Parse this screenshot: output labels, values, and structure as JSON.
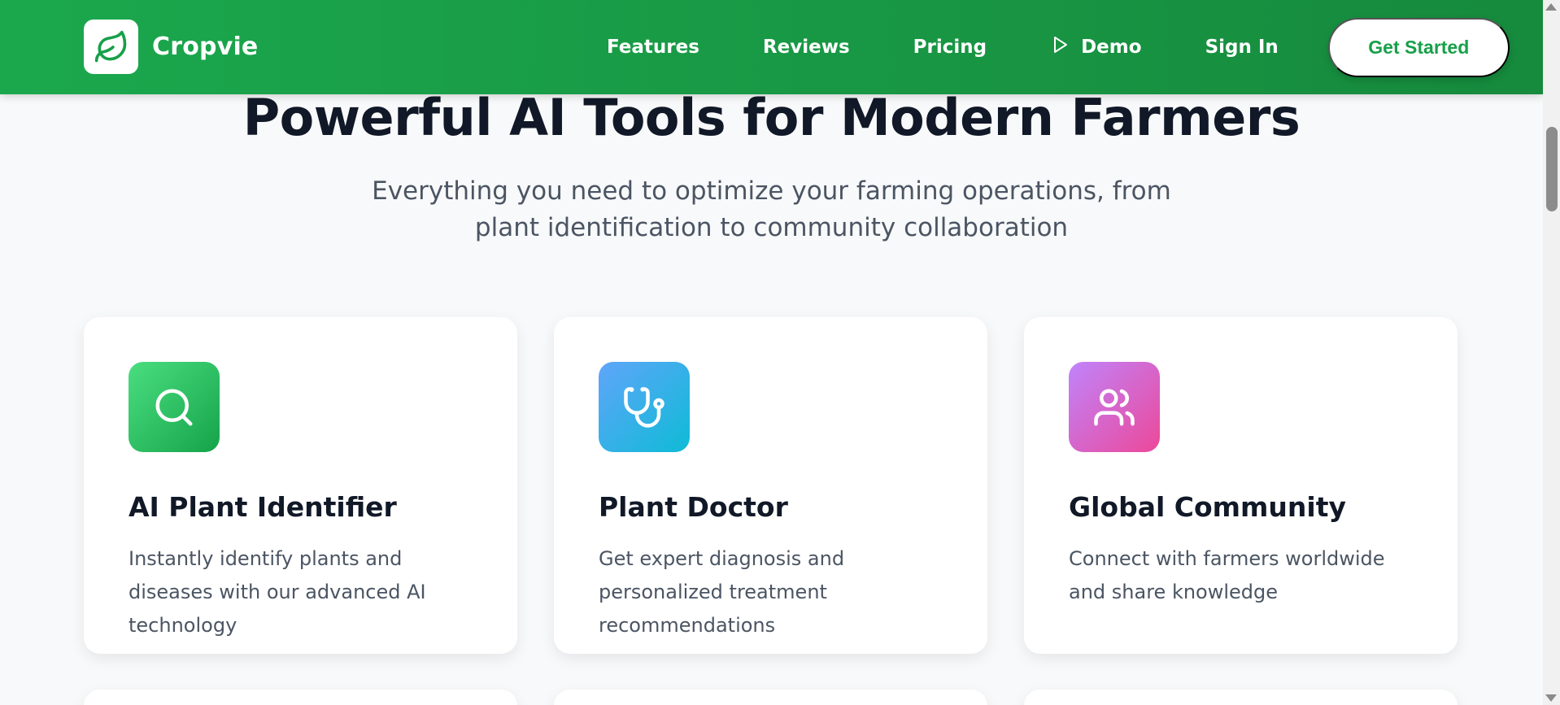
{
  "header": {
    "brand_name": "Cropvie",
    "brand_icon": "leaf-icon",
    "nav": {
      "features": "Features",
      "reviews": "Reviews",
      "pricing": "Pricing",
      "demo": "Demo",
      "demo_icon": "play-icon",
      "signin": "Sign In"
    },
    "cta_label": "Get Started"
  },
  "section": {
    "title": "Powerful AI Tools for Modern Farmers",
    "subtitle": "Everything you need to optimize your farming operations, from plant identification to community collaboration"
  },
  "cards": [
    {
      "title": "AI Plant Identifier",
      "description": "Instantly identify plants and diseases with our advanced AI technology",
      "icon": "search-icon",
      "gradient": [
        "#4ade80",
        "#16a34a"
      ]
    },
    {
      "title": "Plant Doctor",
      "description": "Get expert diagnosis and personalized treatment recommendations",
      "icon": "stethoscope-icon",
      "gradient": [
        "#60a5fa",
        "#0ebbd6"
      ]
    },
    {
      "title": "Global Community",
      "description": "Connect with farmers worldwide and share knowledge",
      "icon": "users-icon",
      "gradient": [
        "#c084fc",
        "#ec4899"
      ]
    }
  ],
  "colors": {
    "brand_green": "#1ba84d",
    "title_text": "#111827",
    "body_text": "#4b5563",
    "page_bg": "#f8f9fa"
  }
}
